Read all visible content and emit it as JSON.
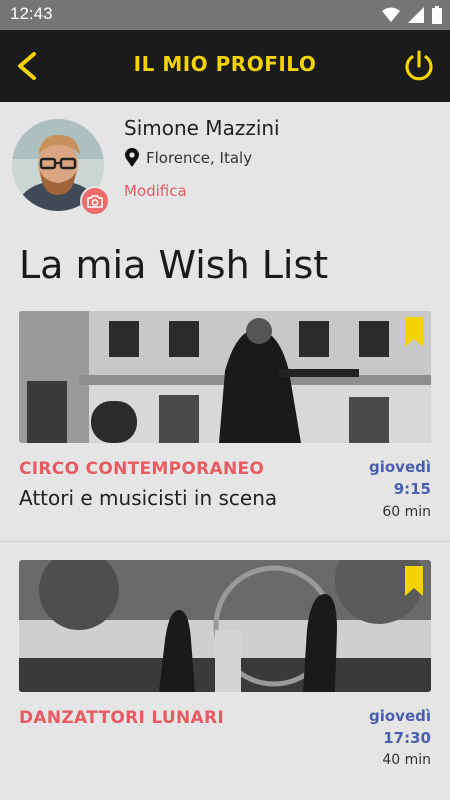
{
  "status_bar": {
    "time": "12:43"
  },
  "app_bar": {
    "title": "IL MIO PROFILO"
  },
  "profile": {
    "name": "Simone Mazzini",
    "location": "Florence, Italy",
    "edit_label": "Modifica"
  },
  "wishlist": {
    "title": "La mia Wish List",
    "items": [
      {
        "category": "CIRCO CONTEMPORANEO",
        "subtitle": "Attori e musicisti in scena",
        "day": "giovedì",
        "time": "9:15",
        "duration": "60 min"
      },
      {
        "category": "DANZATTORI LUNARI",
        "subtitle": "",
        "day": "giovedì",
        "time": "17:30",
        "duration": "40 min"
      }
    ]
  },
  "colors": {
    "accent_yellow": "#f5d300",
    "accent_red": "#e85b62",
    "time_blue": "#4a5fb0",
    "app_bar": "#1b1b1b"
  }
}
